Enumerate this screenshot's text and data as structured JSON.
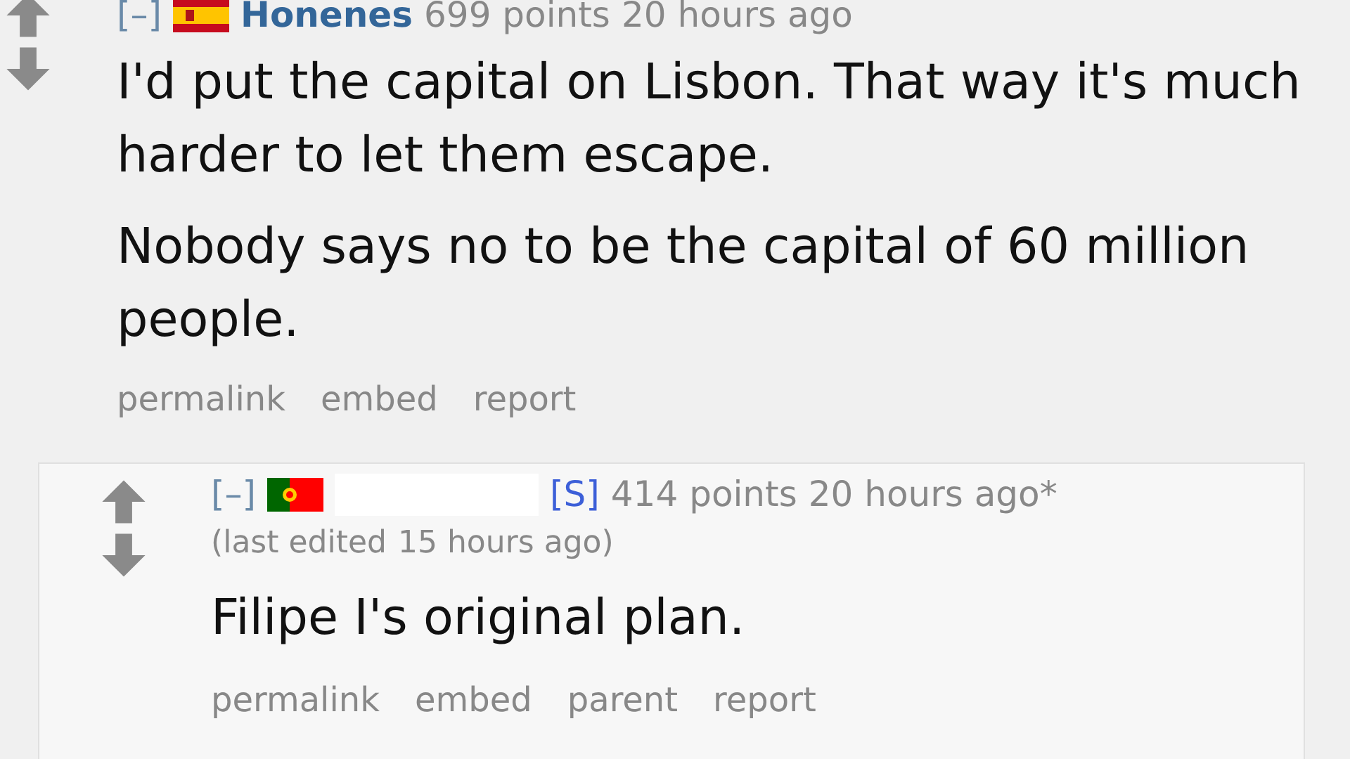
{
  "comment": {
    "collapse": "[–]",
    "author": "Honenes",
    "score": "699 points",
    "time": "20 hours ago",
    "paragraphs": [
      "I'd put the capital on Lisbon. That way it's much harder to let them escape.",
      "Nobody says no to be the capital of 60 million people."
    ],
    "buttons": [
      "permalink",
      "embed",
      "report"
    ],
    "reply": {
      "collapse": "[–]",
      "author_hidden": true,
      "submitter": "[S]",
      "score": "414 points",
      "time": "20 hours ago*",
      "edited": [
        "(last edited",
        "15 hours ago)"
      ],
      "paragraphs": [
        "Filipe I's original plan."
      ],
      "buttons": [
        "permalink",
        "embed",
        "parent",
        "report"
      ]
    }
  }
}
